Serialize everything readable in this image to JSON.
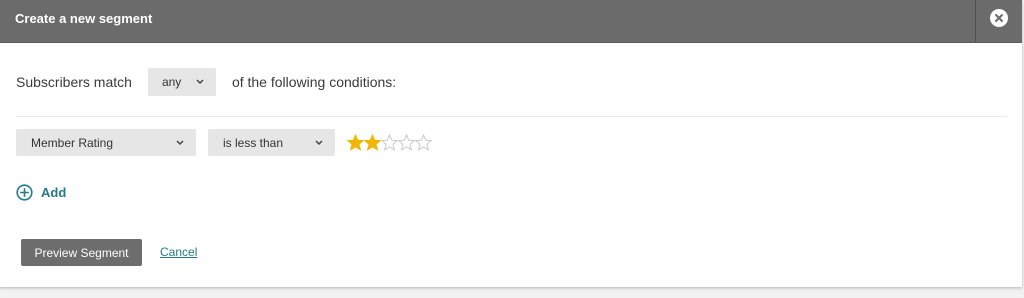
{
  "dialog": {
    "title": "Create a new segment"
  },
  "match": {
    "prefix": "Subscribers match",
    "selected": "any",
    "suffix": "of the following conditions:"
  },
  "condition": {
    "field": "Member Rating",
    "operator": "is less than",
    "rating_value": 2,
    "rating_max": 5
  },
  "actions": {
    "add_label": "Add",
    "preview_label": "Preview Segment",
    "cancel_label": "Cancel"
  },
  "colors": {
    "header_bg": "#6b6b6b",
    "link": "#247a86",
    "star_filled": "#f2b705",
    "star_empty": "#c8c8c8",
    "button_bg": "#6d6d6d"
  },
  "icons": {
    "close": "close-icon",
    "chevron": "chevron-down-icon",
    "add": "plus-circle-icon",
    "star": "star-icon"
  }
}
